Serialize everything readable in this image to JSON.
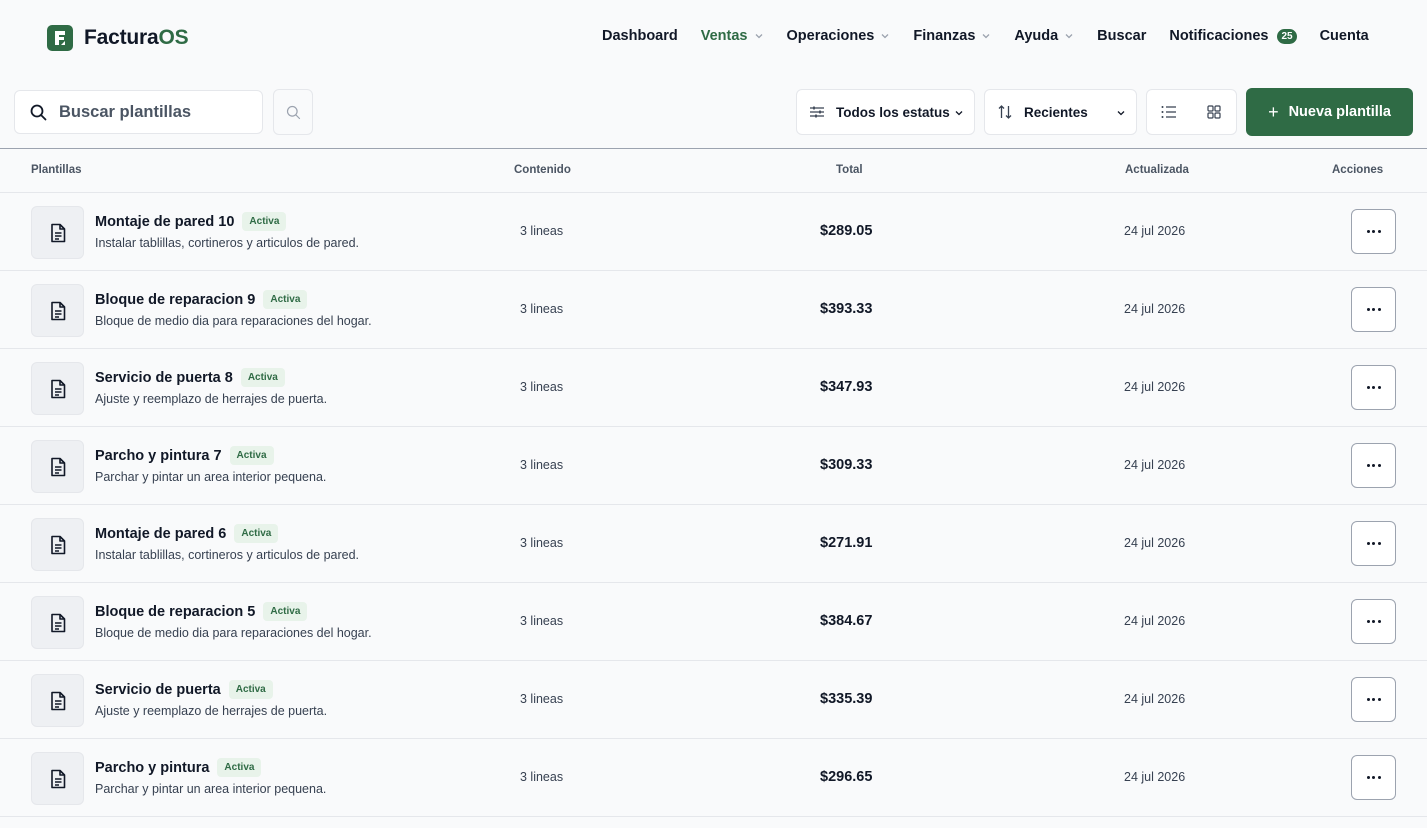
{
  "brand": {
    "name_main": "Factura",
    "name_accent": "OS",
    "accent_color": "#2f6b45"
  },
  "nav": {
    "items": [
      {
        "label": "Dashboard",
        "dropdown": false,
        "active": false
      },
      {
        "label": "Ventas",
        "dropdown": true,
        "active": true
      },
      {
        "label": "Operaciones",
        "dropdown": true,
        "active": false
      },
      {
        "label": "Finanzas",
        "dropdown": true,
        "active": false
      },
      {
        "label": "Ayuda",
        "dropdown": true,
        "active": false
      },
      {
        "label": "Buscar",
        "dropdown": false,
        "active": false
      },
      {
        "label": "Notificaciones",
        "dropdown": false,
        "active": false,
        "badge": "25"
      },
      {
        "label": "Cuenta",
        "dropdown": false,
        "active": false
      }
    ]
  },
  "toolbar": {
    "search_placeholder": "Buscar plantillas",
    "status_filter": "Todos los estatus",
    "sort": "Recientes",
    "new_button": "Nueva plantilla"
  },
  "table": {
    "headers": {
      "templates": "Plantillas",
      "content": "Contenido",
      "total": "Total",
      "updated": "Actualizada",
      "actions": "Acciones"
    },
    "rows": [
      {
        "name": "Montaje de pared 10",
        "status": "Activa",
        "description": "Instalar tablillas, cortineros y articulos de pared.",
        "content": "3 lineas",
        "total": "$289.05",
        "updated": "24 jul 2026"
      },
      {
        "name": "Bloque de reparacion 9",
        "status": "Activa",
        "description": "Bloque de medio dia para reparaciones del hogar.",
        "content": "3 lineas",
        "total": "$393.33",
        "updated": "24 jul 2026"
      },
      {
        "name": "Servicio de puerta 8",
        "status": "Activa",
        "description": "Ajuste y reemplazo de herrajes de puerta.",
        "content": "3 lineas",
        "total": "$347.93",
        "updated": "24 jul 2026"
      },
      {
        "name": "Parcho y pintura 7",
        "status": "Activa",
        "description": "Parchar y pintar un area interior pequena.",
        "content": "3 lineas",
        "total": "$309.33",
        "updated": "24 jul 2026"
      },
      {
        "name": "Montaje de pared 6",
        "status": "Activa",
        "description": "Instalar tablillas, cortineros y articulos de pared.",
        "content": "3 lineas",
        "total": "$271.91",
        "updated": "24 jul 2026"
      },
      {
        "name": "Bloque de reparacion 5",
        "status": "Activa",
        "description": "Bloque de medio dia para reparaciones del hogar.",
        "content": "3 lineas",
        "total": "$384.67",
        "updated": "24 jul 2026"
      },
      {
        "name": "Servicio de puerta",
        "status": "Activa",
        "description": "Ajuste y reemplazo de herrajes de puerta.",
        "content": "3 lineas",
        "total": "$335.39",
        "updated": "24 jul 2026"
      },
      {
        "name": "Parcho y pintura",
        "status": "Activa",
        "description": "Parchar y pintar un area interior pequena.",
        "content": "3 lineas",
        "total": "$296.65",
        "updated": "24 jul 2026"
      }
    ]
  }
}
